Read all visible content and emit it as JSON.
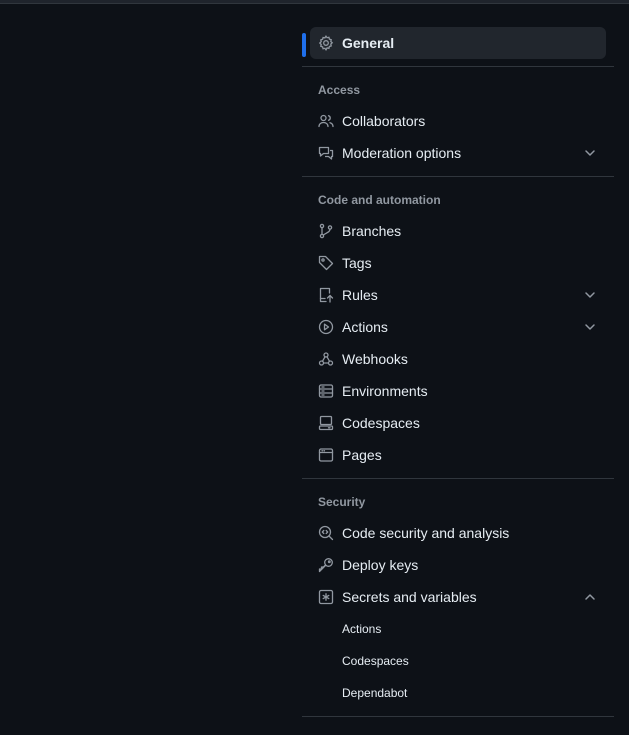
{
  "nav": {
    "general": {
      "label": "General",
      "icon": "gear-icon"
    },
    "access": {
      "title": "Access",
      "items": [
        {
          "label": "Collaborators",
          "icon": "people-icon",
          "expandable": false
        },
        {
          "label": "Moderation options",
          "icon": "report-icon",
          "expandable": true,
          "expanded": false
        }
      ]
    },
    "code_automation": {
      "title": "Code and automation",
      "items": [
        {
          "label": "Branches",
          "icon": "git-branch-icon",
          "expandable": false
        },
        {
          "label": "Tags",
          "icon": "tag-icon",
          "expandable": false
        },
        {
          "label": "Rules",
          "icon": "repo-push-icon",
          "expandable": true,
          "expanded": false
        },
        {
          "label": "Actions",
          "icon": "play-icon",
          "expandable": true,
          "expanded": false
        },
        {
          "label": "Webhooks",
          "icon": "webhook-icon",
          "expandable": false
        },
        {
          "label": "Environments",
          "icon": "server-icon",
          "expandable": false
        },
        {
          "label": "Codespaces",
          "icon": "codespaces-icon",
          "expandable": false
        },
        {
          "label": "Pages",
          "icon": "browser-icon",
          "expandable": false
        }
      ]
    },
    "security": {
      "title": "Security",
      "items": [
        {
          "label": "Code security and analysis",
          "icon": "codescan-icon",
          "expandable": false
        },
        {
          "label": "Deploy keys",
          "icon": "key-icon",
          "expandable": false
        },
        {
          "label": "Secrets and variables",
          "icon": "key-asterisk-icon",
          "expandable": true,
          "expanded": true
        }
      ],
      "subitems": [
        "Actions",
        "Codespaces",
        "Dependabot"
      ]
    }
  },
  "colors": {
    "background": "#0d1117",
    "active_bg": "#21262d",
    "accent": "#1f6feb",
    "divider": "#30363d",
    "muted_text": "#9198a1",
    "text": "#e6edf3",
    "icon": "#9198a1"
  }
}
